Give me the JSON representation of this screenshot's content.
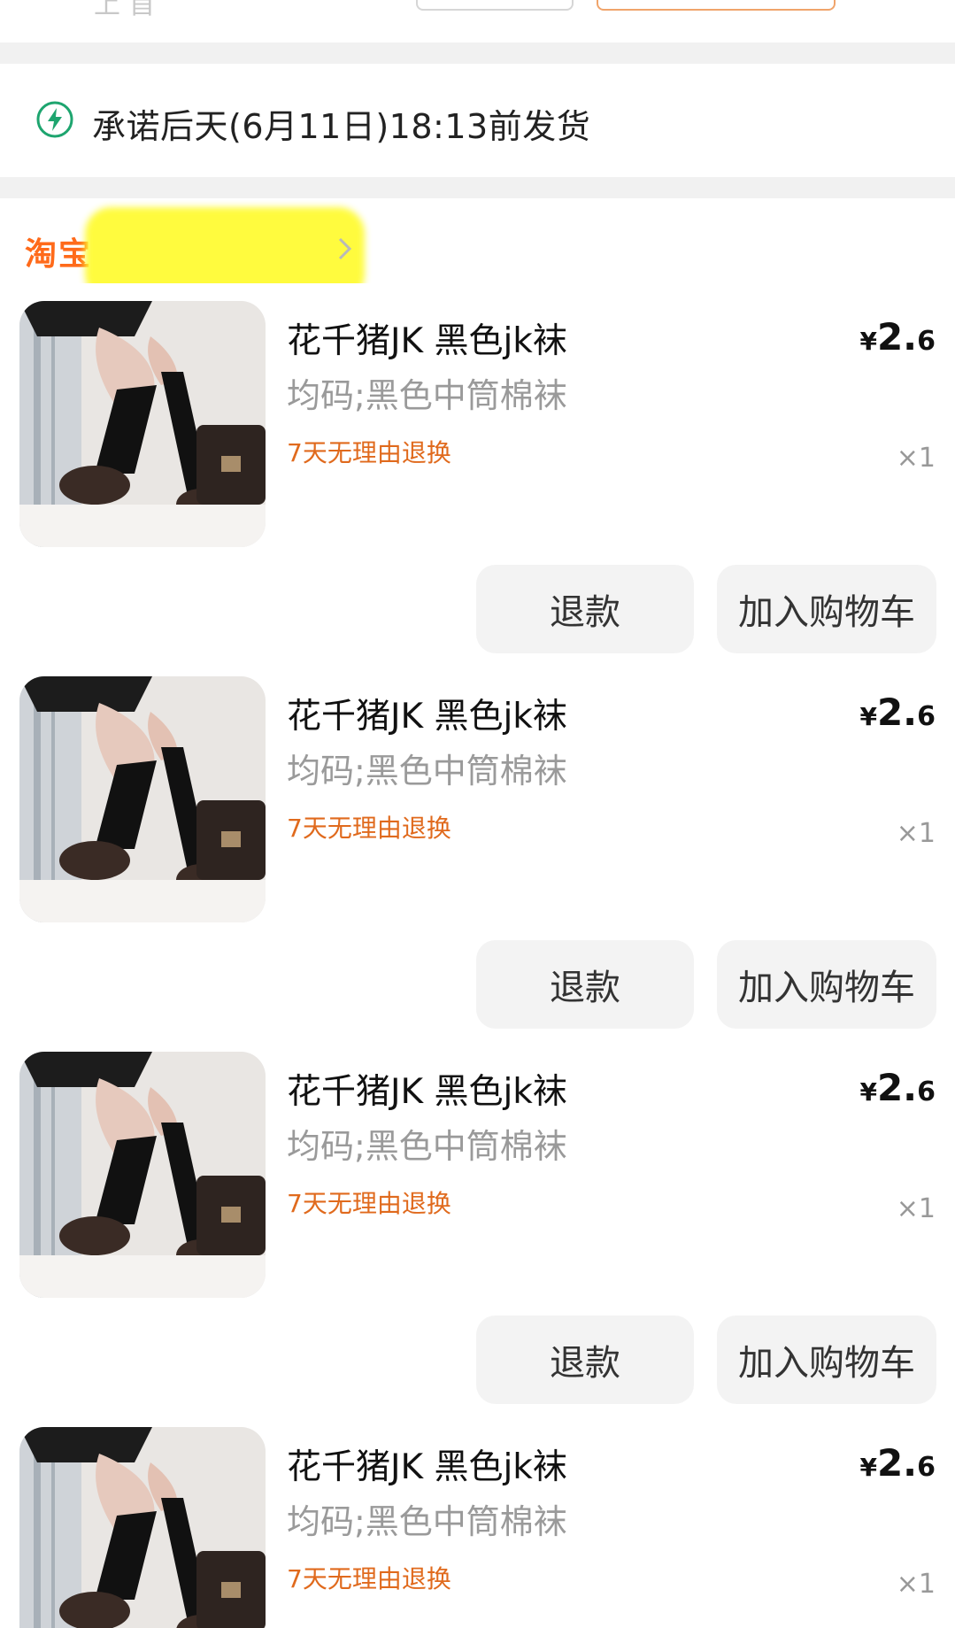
{
  "header_partial": {
    "text": "上 首"
  },
  "delivery": {
    "promise": "承诺后天(6月11日)18:13前发货",
    "icon": "lightning-bolt-icon",
    "accent": "#1ea56f"
  },
  "shop": {
    "platform": "淘宝",
    "name_redacted": true
  },
  "items": [
    {
      "title": "花千猪JK 黑色jk袜",
      "sku": "均码;黑色中筒棉袜",
      "badge": "7天无理由退换",
      "price_currency": "¥",
      "price_int": "2.",
      "price_dec": "6",
      "qty": "×1",
      "refund_label": "退款",
      "add_cart_label": "加入购物车"
    },
    {
      "title": "花千猪JK 黑色jk袜",
      "sku": "均码;黑色中筒棉袜",
      "badge": "7天无理由退换",
      "price_currency": "¥",
      "price_int": "2.",
      "price_dec": "6",
      "qty": "×1",
      "refund_label": "退款",
      "add_cart_label": "加入购物车"
    },
    {
      "title": "花千猪JK 黑色jk袜",
      "sku": "均码;黑色中筒棉袜",
      "badge": "7天无理由退换",
      "price_currency": "¥",
      "price_int": "2.",
      "price_dec": "6",
      "qty": "×1",
      "refund_label": "退款",
      "add_cart_label": "加入购物车"
    },
    {
      "title": "花千猪JK 黑色jk袜",
      "sku": "均码;黑色中筒棉袜",
      "badge": "7天无理由退换",
      "price_currency": "¥",
      "price_int": "2.",
      "price_dec": "6",
      "qty": "×1"
    }
  ],
  "colors": {
    "brand_orange": "#ff6a1a",
    "badge_orange": "#e06a1d",
    "button_bg": "#f3f3f3",
    "divider_bg": "#f1f1f1"
  }
}
